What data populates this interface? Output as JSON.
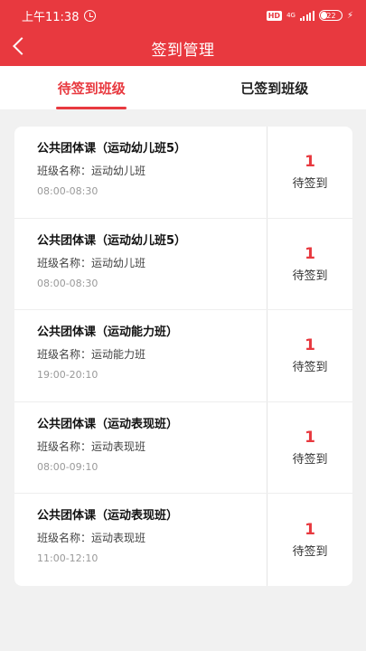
{
  "status_bar": {
    "time": "上午11:38",
    "network": "4G",
    "battery": "22"
  },
  "nav": {
    "title": "签到管理"
  },
  "tabs": [
    {
      "label": "待签到班级",
      "active": true
    },
    {
      "label": "已签到班级",
      "active": false
    }
  ],
  "classes": [
    {
      "title": "公共团体课（运动幼儿班5）",
      "class_name": "班级名称：运动幼儿班",
      "time": "08:00-08:30",
      "count": "1",
      "status": "待签到"
    },
    {
      "title": "公共团体课（运动幼儿班5）",
      "class_name": "班级名称：运动幼儿班",
      "time": "08:00-08:30",
      "count": "1",
      "status": "待签到"
    },
    {
      "title": "公共团体课（运动能力班）",
      "class_name": "班级名称：运动能力班",
      "time": "19:00-20:10",
      "count": "1",
      "status": "待签到"
    },
    {
      "title": "公共团体课（运动表现班）",
      "class_name": "班级名称：运动表现班",
      "time": "08:00-09:10",
      "count": "1",
      "status": "待签到"
    },
    {
      "title": "公共团体课（运动表现班）",
      "class_name": "班级名称：运动表现班",
      "time": "11:00-12:10",
      "count": "1",
      "status": "待签到"
    }
  ],
  "colors": {
    "accent": "#e8393f",
    "background": "#f1f1f1"
  }
}
